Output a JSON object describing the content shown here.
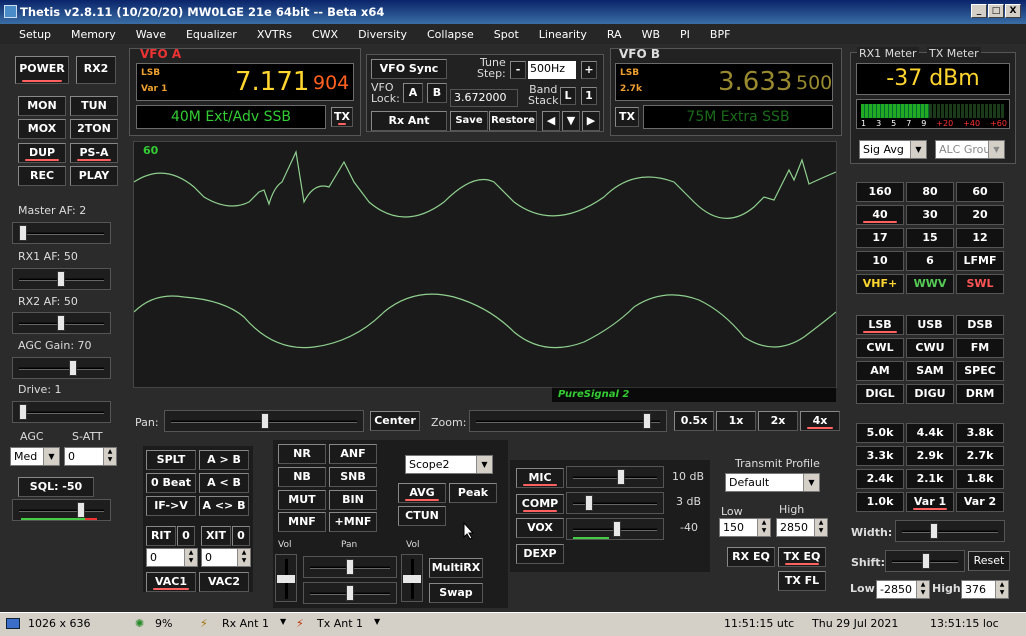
{
  "window": {
    "title": "Thetis v2.8.11 (10/20/20) MW0LGE 21e 64bit  --  Beta x64",
    "min": "_",
    "max": "□",
    "close": "X"
  },
  "menu": [
    "Setup",
    "Memory",
    "Wave",
    "Equalizer",
    "XVTRs",
    "CWX",
    "Diversity",
    "Collapse",
    "Spot",
    "Linearity",
    "RA",
    "WB",
    "PI",
    "BPF"
  ],
  "left": {
    "power": "POWER",
    "rx2": "RX2",
    "mon": "MON",
    "tun": "TUN",
    "mox": "MOX",
    "two_ton": "2TON",
    "dup": "DUP",
    "psa": "PS-A",
    "rec": "REC",
    "play": "PLAY",
    "master_af": "Master AF:  2",
    "rx1_af": "RX1 AF:  50",
    "rx2_af": "RX2 AF:  50",
    "agc_gain": "AGC Gain:  70",
    "drive": "Drive:  1",
    "agc": "AGC",
    "satt": "S-ATT",
    "agc_mode": "Med",
    "satt_val": "0",
    "sql": "SQL:  -50"
  },
  "vfoa": {
    "title": "VFO A",
    "mode": "LSB",
    "filter": "Var 1",
    "freq_main": "7.171",
    "freq_sub": "904",
    "band": "40M Ext/Adv SSB",
    "tx": "TX"
  },
  "vfo_mid": {
    "sync": "VFO Sync",
    "tune_step": "Tune\nStep:",
    "tune_step_l1": "Tune",
    "tune_step_l2": "Step:",
    "minus": "-",
    "plus": "+",
    "step": "500Hz",
    "lock_l1": "VFO",
    "lock_l2": "Lock:",
    "a": "A",
    "b": "B",
    "lock_freq": "3.672000",
    "band_stack_l1": "Band",
    "band_stack_l2": "Stack",
    "l": "L",
    "one": "1",
    "rx_ant": "Rx Ant",
    "save": "Save",
    "restore": "Restore",
    "left_arrow": "◀",
    "down_arrow": "▼",
    "right_arrow": "▶"
  },
  "vfob": {
    "title": "VFO B",
    "mode": "LSB",
    "filter": "2.7k",
    "freq_main": "3.633",
    "freq_sub": "500",
    "band": "75M Extra SSB",
    "tx": "TX"
  },
  "meter": {
    "rx_label": "RX1 Meter",
    "tx_label": "TX Meter",
    "reading": "-37 dBm",
    "scale": [
      "1",
      "3",
      "5",
      "7",
      "9",
      "+20",
      "+40",
      "+60"
    ],
    "rx_mode": "Sig Avg",
    "tx_mode": "ALC Group"
  },
  "display": {
    "label": "60",
    "pure_signal": "PureSignal 2"
  },
  "pan_zoom": {
    "pan": "Pan:",
    "center": "Center",
    "zoom": "Zoom:",
    "z05": "0.5x",
    "z1": "1x",
    "z2": "2x",
    "z4": "4x"
  },
  "bands": [
    "160",
    "80",
    "60",
    "40",
    "30",
    "20",
    "17",
    "15",
    "12",
    "10",
    "6",
    "LFMF",
    "VHF+",
    "WWV",
    "SWL"
  ],
  "modes": [
    "LSB",
    "USB",
    "DSB",
    "CWL",
    "CWU",
    "FM",
    "AM",
    "SAM",
    "SPEC",
    "DIGL",
    "DIGU",
    "DRM"
  ],
  "filters": [
    "5.0k",
    "4.4k",
    "3.8k",
    "3.3k",
    "2.9k",
    "2.7k",
    "2.4k",
    "2.1k",
    "1.8k",
    "1.0k",
    "Var 1",
    "Var 2"
  ],
  "filter_ctrl": {
    "width": "Width:",
    "shift": "Shift:",
    "reset": "Reset",
    "low": "Low",
    "low_val": "-2850",
    "high": "High",
    "high_val": "376"
  },
  "bottom": {
    "splt": "SPLT",
    "a_gt_b": "A > B",
    "zero_beat": "0 Beat",
    "a_lt_b": "A < B",
    "if_v": "IF->V",
    "a_sw_b": "A <> B",
    "rit": "RIT",
    "rit_val": "0",
    "xit": "XIT",
    "xit_val": "0",
    "rit_num": "0",
    "xit_num": "0",
    "vac1": "VAC1",
    "vac2": "VAC2",
    "nr": "NR",
    "anf": "ANF",
    "nb": "NB",
    "snb": "SNB",
    "mut": "MUT",
    "bin": "BIN",
    "mnf": "MNF",
    "pmnf": "+MNF",
    "vol1": "Vol",
    "pan": "Pan",
    "vol2": "Vol",
    "scope": "Scope2",
    "avg": "AVG",
    "peak": "Peak",
    "ctun": "CTUN",
    "multirx": "MultiRX",
    "swap": "Swap",
    "mic": "MIC",
    "mic_db": "10 dB",
    "comp": "COMP",
    "comp_db": "3 dB",
    "vox": "VOX",
    "vox_val": "-40",
    "dexp": "DEXP",
    "tx_profile": "Transmit Profile",
    "profile": "Default",
    "low": "Low",
    "low_val": "150",
    "high": "High",
    "high_val": "2850",
    "rx_eq": "RX EQ",
    "tx_eq": "TX EQ",
    "tx_fl": "TX FL"
  },
  "status": {
    "res": "1026 x 636",
    "cpu": "9%",
    "rx_ant": "Rx Ant 1",
    "tx_ant": "Tx Ant 1",
    "utc": "11:51:15 utc",
    "date": "Thu 29 Jul 2021",
    "loc": "13:51:15 loc"
  }
}
